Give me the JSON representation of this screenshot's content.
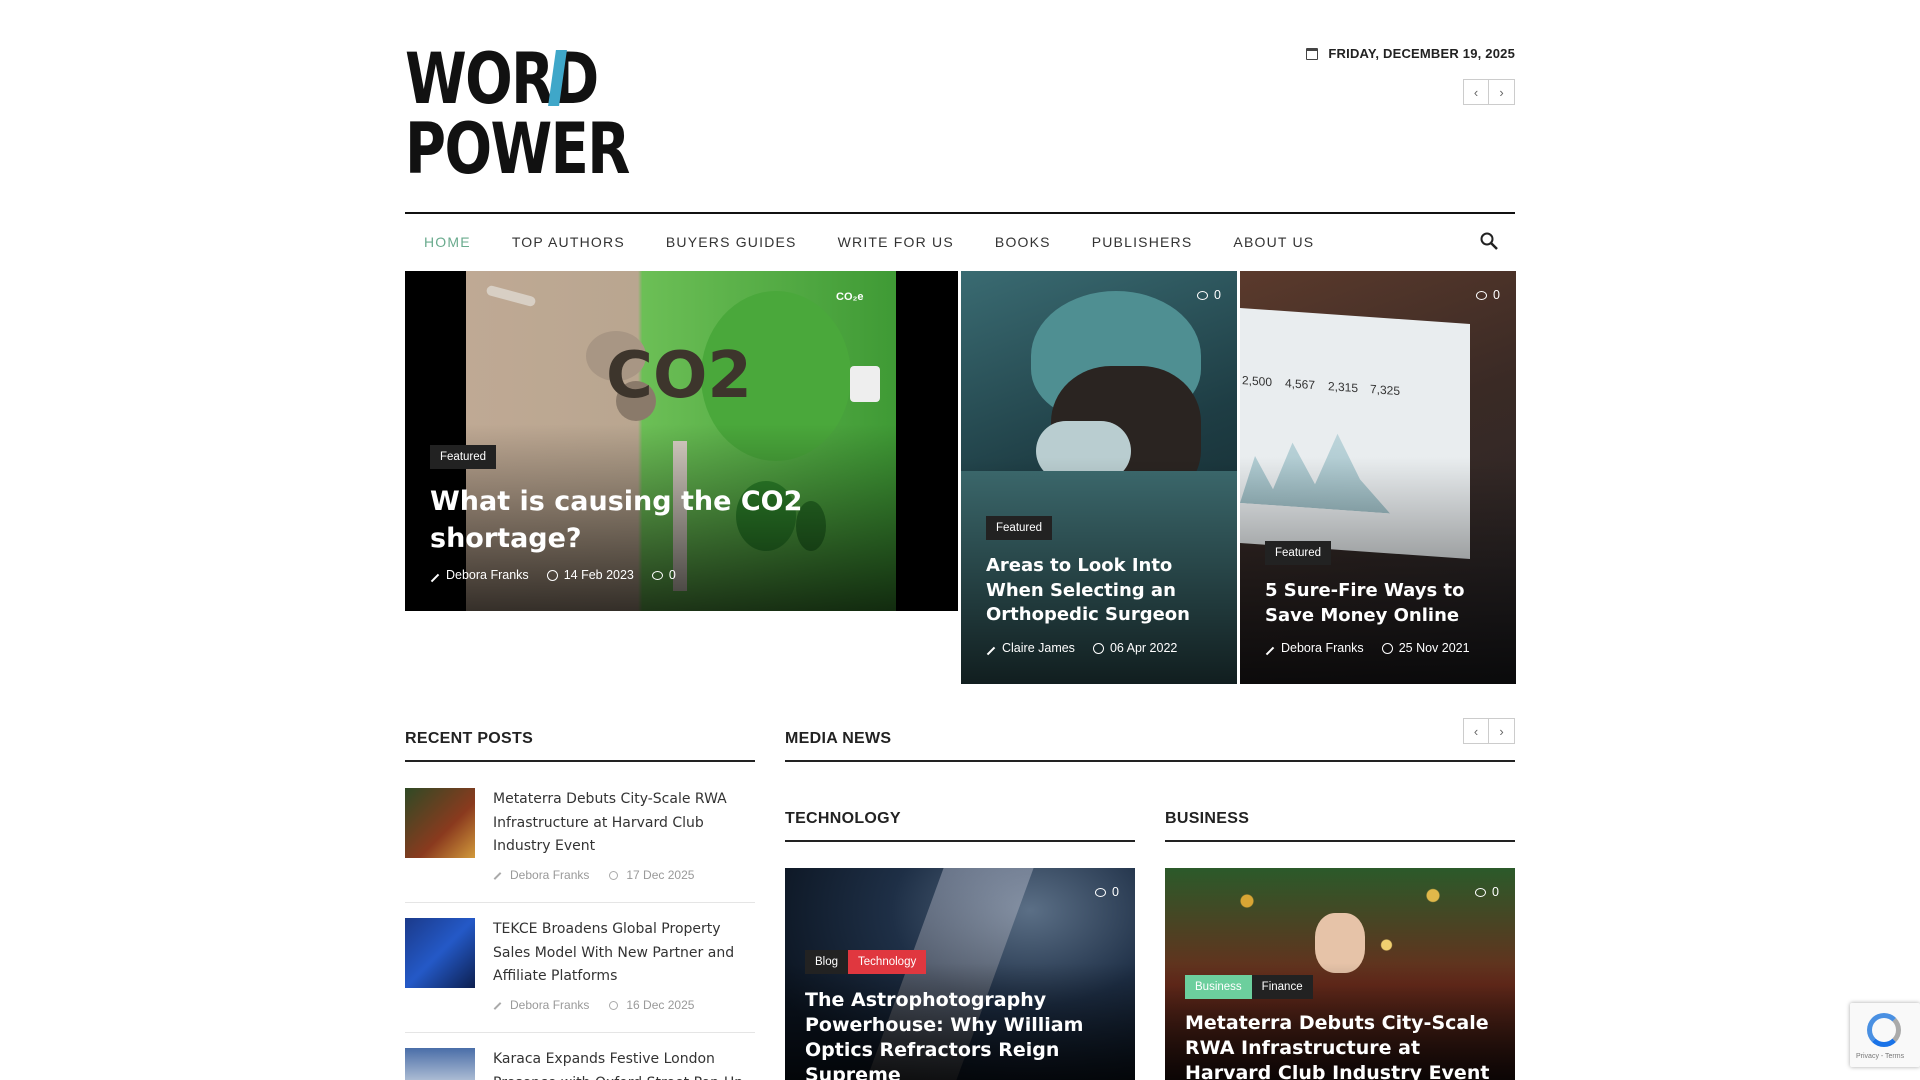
{
  "header": {
    "logo_line1": "WORD",
    "logo_line2": "POWER",
    "date": "FRIDAY, DECEMBER 19, 2025",
    "prev": "‹",
    "next": "›"
  },
  "nav": {
    "items": [
      "HOME",
      "TOP AUTHORS",
      "BUYERS GUIDES",
      "WRITE FOR US",
      "BOOKS",
      "PUBLISHERS",
      "ABOUT US"
    ]
  },
  "hero": {
    "main": {
      "image_text": "CO2",
      "image_text2": "CO₂e",
      "badge": "Featured",
      "title": "What is causing the CO2 shortage?",
      "author": "Debora Franks",
      "date": "14 Feb 2023",
      "comments": "0"
    },
    "card1": {
      "comments": "0",
      "badge": "Featured",
      "title": "Areas to Look Into When Selecting an Orthopedic Surgeon",
      "author": "Claire James",
      "date": "06 Apr 2022"
    },
    "card2": {
      "comments": "0",
      "badge": "Featured",
      "title": "5 Sure-Fire Ways to Save Money Online",
      "author": "Debora Franks",
      "date": "25 Nov 2021",
      "screen_numbers": [
        "2,500",
        "4,567",
        "2,315",
        "7,325"
      ]
    }
  },
  "recent_posts": {
    "title": "RECENT POSTS",
    "items": [
      {
        "title": "Metaterra Debuts City-Scale RWA Infrastructure at Harvard Club Industry Event",
        "author": "Debora Franks",
        "date": "17 Dec 2025"
      },
      {
        "title": "TEKCE Broadens Global Property Sales Model With New Partner and Affiliate Platforms",
        "author": "Debora Franks",
        "date": "16 Dec 2025"
      },
      {
        "title": "Karaca Expands Festive London Presence with Oxford Street Pop-Up",
        "author": "",
        "date": ""
      }
    ]
  },
  "media_news": {
    "title": "MEDIA NEWS",
    "technology": {
      "title": "TECHNOLOGY",
      "card": {
        "comments": "0",
        "badges": [
          "Blog",
          "Technology"
        ],
        "title": "The Astrophotography Powerhouse: Why William Optics Refractors Reign Supreme"
      }
    },
    "business": {
      "title": "BUSINESS",
      "card": {
        "comments": "0",
        "badges": [
          "Business",
          "Finance"
        ],
        "title": "Metaterra Debuts City-Scale RWA Infrastructure at Harvard Club Industry Event"
      }
    }
  },
  "recaptcha": {
    "text": "Privacy - Terms"
  },
  "colors": {
    "accent_green": "#6aab8e",
    "badge_red": "#e0373f",
    "badge_green": "#6ccf9d",
    "logo_blue": "#3fa7c9"
  }
}
